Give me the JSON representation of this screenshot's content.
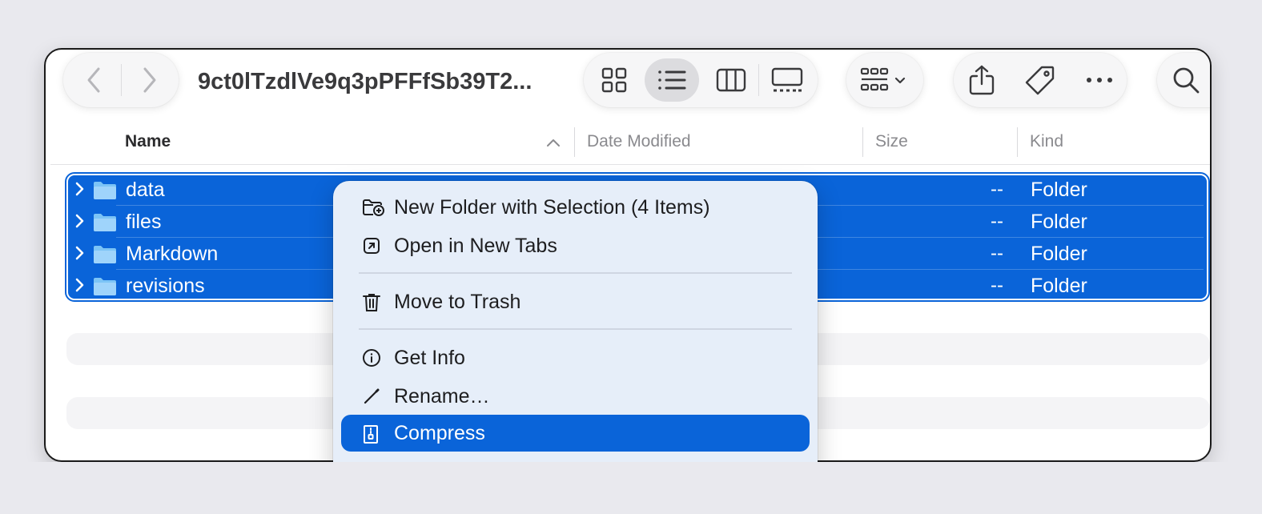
{
  "window": {
    "title": "9ct0lTzdlVe9q3pPFFfSb39T2...",
    "nav": {
      "back_icon": "chevron-left-icon",
      "forward_icon": "chevron-right-icon"
    },
    "view_modes": [
      "icon-view-icon",
      "list-view-icon",
      "column-view-icon",
      "gallery-view-icon"
    ],
    "active_view": "list",
    "toolbar_icons": [
      "group-by-icon",
      "share-icon",
      "tag-icon",
      "more-icon",
      "search-icon"
    ]
  },
  "columns": {
    "name": "Name",
    "date_modified": "Date Modified",
    "size": "Size",
    "kind": "Kind"
  },
  "rows": [
    {
      "name": "data",
      "size": "--",
      "kind": "Folder"
    },
    {
      "name": "files",
      "size": "--",
      "kind": "Folder"
    },
    {
      "name": "Markdown",
      "size": "--",
      "kind": "Folder"
    },
    {
      "name": "revisions",
      "size": "--",
      "kind": "Folder"
    }
  ],
  "context_menu": {
    "items": [
      {
        "label": "New Folder with Selection (4 Items)",
        "icon": "new-folder-icon"
      },
      {
        "label": "Open in New Tabs",
        "icon": "open-tab-icon"
      },
      {
        "label": "Move to Trash",
        "icon": "trash-icon"
      },
      {
        "label": "Get Info",
        "icon": "info-icon"
      },
      {
        "label": "Rename…",
        "icon": "pencil-icon"
      },
      {
        "label": "Compress",
        "icon": "archive-icon",
        "highlighted": true
      }
    ]
  },
  "colors": {
    "selection": "#0a64d9",
    "menu_background": "#e6eef9",
    "desktop": "#e9e9ee"
  }
}
